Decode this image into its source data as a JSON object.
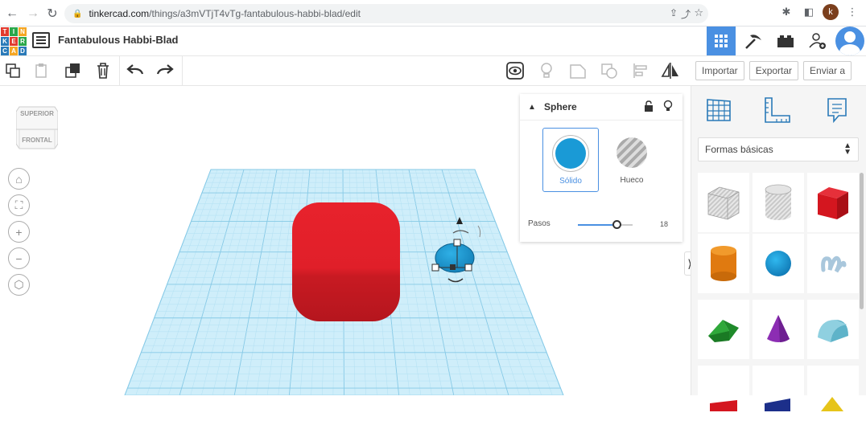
{
  "browser": {
    "url_host": "tinkercad.com",
    "url_path": "/things/a3mVTjT4vTg-fantabulous-habbi-blad/edit",
    "profile_initial": "k"
  },
  "app": {
    "logo_letters": [
      "T",
      "I",
      "N",
      "K",
      "E",
      "R",
      "C",
      "A",
      "D"
    ],
    "design_title": "Fantabulous Habbi-Blad"
  },
  "right_tabs": {
    "import_label": "Importar",
    "export_label": "Exportar",
    "send_label": "Enviar a"
  },
  "viewcube": {
    "top_label": "SUPERIOR",
    "front_label": "FRONTAL"
  },
  "inspector": {
    "title": "Sphere",
    "solid_label": "Sólido",
    "hole_label": "Hueco",
    "steps_label": "Pasos",
    "steps_value": "18",
    "steps_fraction": 0.7
  },
  "shapes_panel": {
    "category": "Formas básicas",
    "shapes": [
      "box-striped",
      "cylinder-striped",
      "box",
      "cylinder",
      "sphere",
      "scribble",
      "roof",
      "cone",
      "round-roof",
      "text",
      "wedge",
      "pyramid"
    ]
  },
  "colors": {
    "accent": "#4a90e2",
    "box_red": "#e0202a",
    "sphere_blue": "#1a9ad6",
    "grid": "#a8dcf0"
  }
}
